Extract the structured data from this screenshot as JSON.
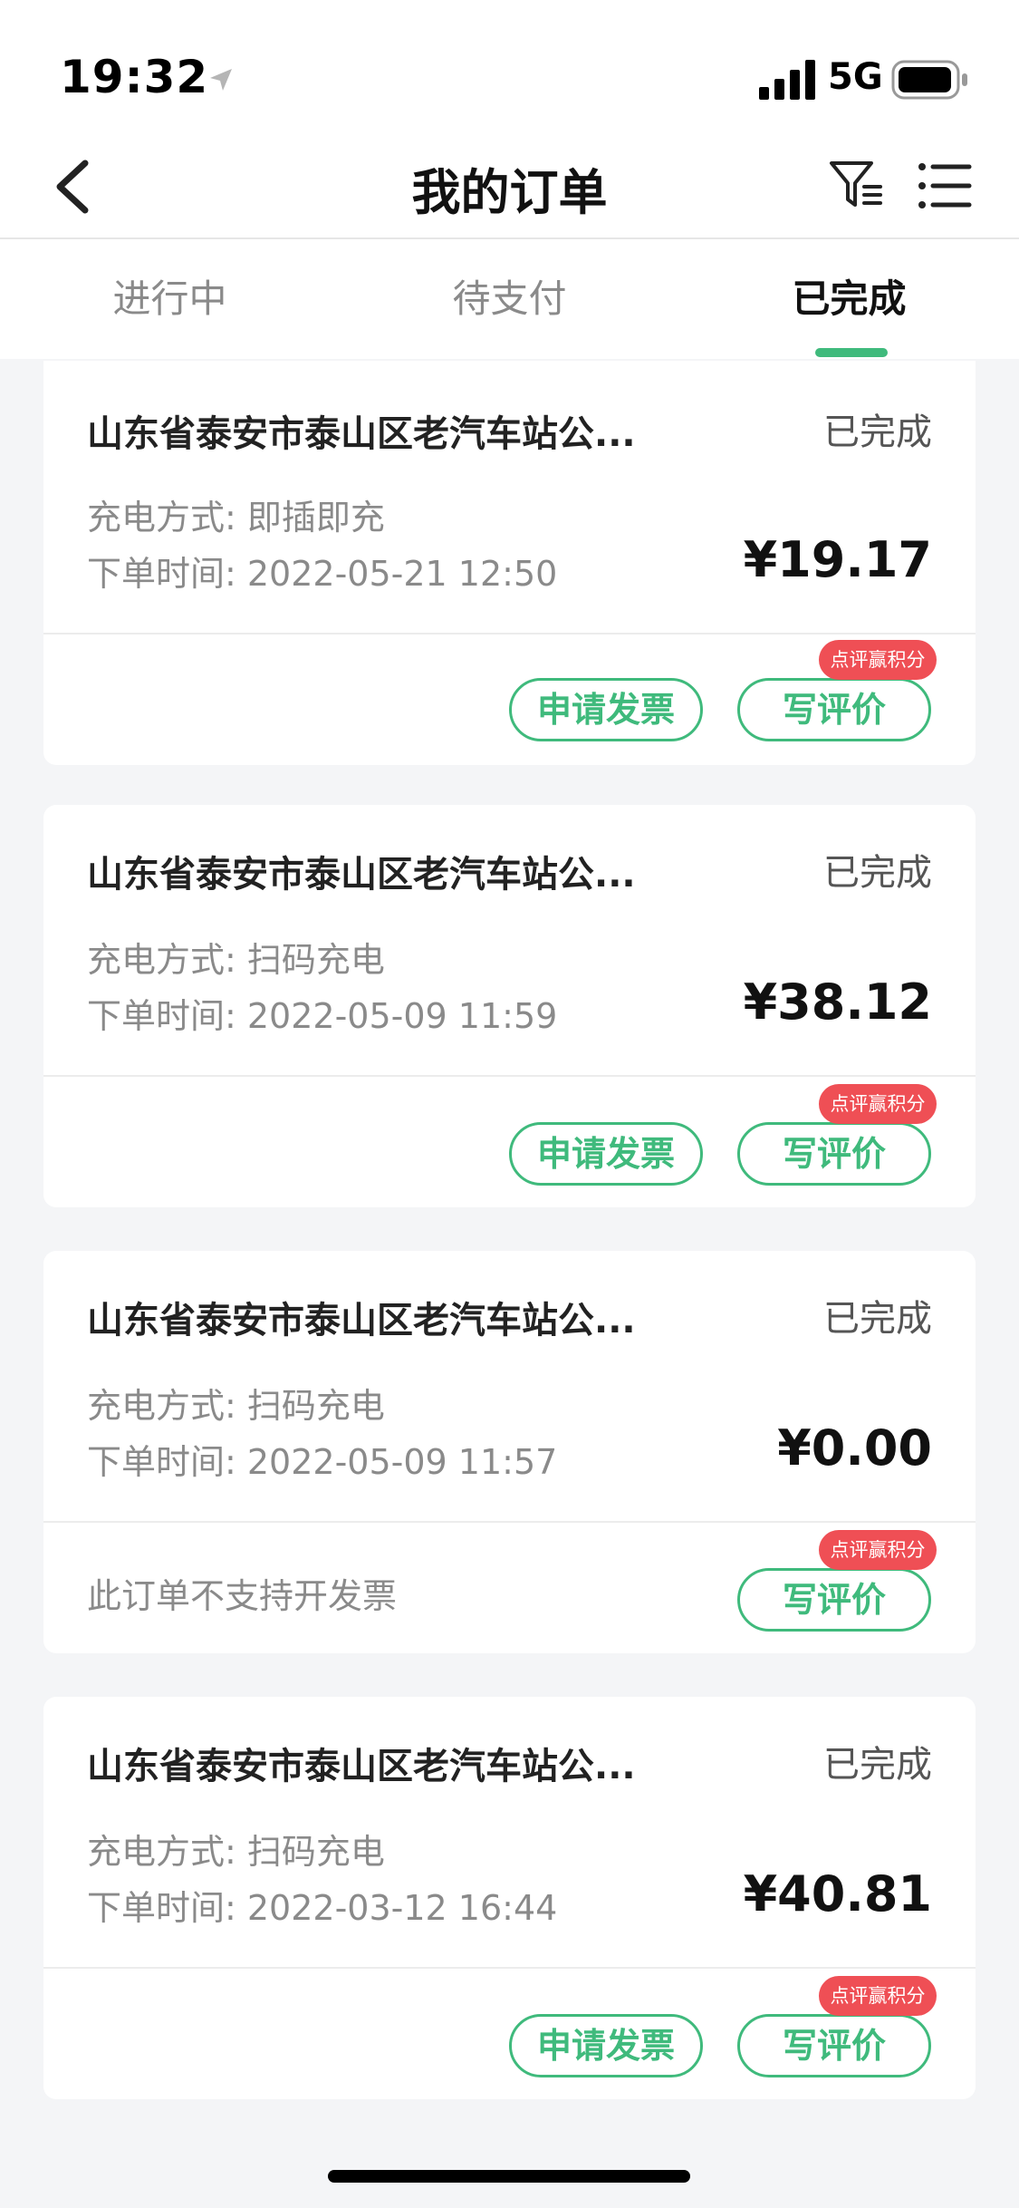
{
  "status_bar": {
    "time": "19:32",
    "network": "5G",
    "icons": [
      "location-arrow-icon",
      "cellular-signal-icon",
      "battery-icon"
    ]
  },
  "nav": {
    "title": "我的订单",
    "icons": [
      "back-chevron-icon",
      "filter-icon",
      "menu-list-icon"
    ]
  },
  "tabs": [
    {
      "label": "进行中",
      "active": false
    },
    {
      "label": "待支付",
      "active": false
    },
    {
      "label": "已完成",
      "active": true
    }
  ],
  "colors": {
    "accent": "#3fba7c",
    "badge": "#ef4f55",
    "background": "#f4f5f7"
  },
  "orders": [
    {
      "station": "山东省泰安市泰山区老汽车站公...",
      "status": "已完成",
      "method": "充电方式: 即插即充",
      "time": "下单时间: 2022-05-21 12:50",
      "price": "¥19.17",
      "invoice_label": "申请发票",
      "review_label": "写评价",
      "badge": "点评赢积分"
    },
    {
      "station": "山东省泰安市泰山区老汽车站公...",
      "status": "已完成",
      "method": "充电方式: 扫码充电",
      "time": "下单时间: 2022-05-09 11:59",
      "price": "¥38.12",
      "invoice_label": "申请发票",
      "review_label": "写评价",
      "badge": "点评赢积分"
    },
    {
      "station": "山东省泰安市泰山区老汽车站公...",
      "status": "已完成",
      "method": "充电方式: 扫码充电",
      "time": "下单时间: 2022-05-09 11:57",
      "price": "¥0.00",
      "no_invoice_note": "此订单不支持开发票",
      "review_label": "写评价",
      "badge": "点评赢积分"
    },
    {
      "station": "山东省泰安市泰山区老汽车站公...",
      "status": "已完成",
      "method": "充电方式: 扫码充电",
      "time": "下单时间: 2022-03-12 16:44",
      "price": "¥40.81",
      "invoice_label": "申请发票",
      "review_label": "写评价",
      "badge": "点评赢积分"
    }
  ]
}
